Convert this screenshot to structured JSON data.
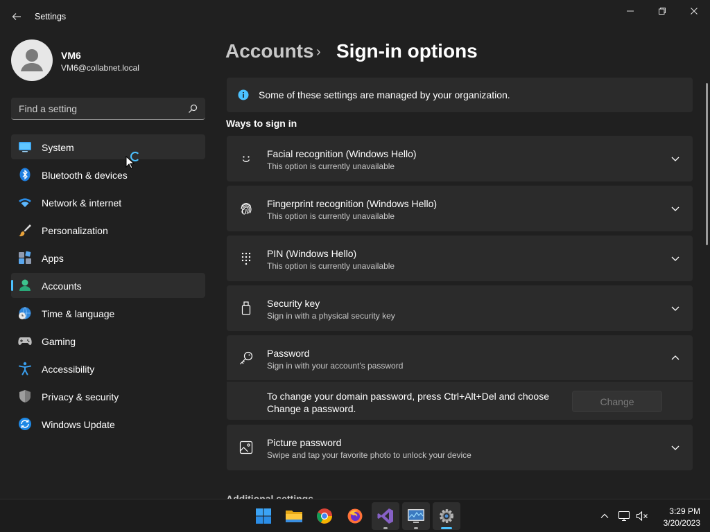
{
  "window": {
    "title": "Settings",
    "minimize_label": "",
    "maximize_label": "",
    "close_label": ""
  },
  "profile": {
    "name": "VM6",
    "email": "VM6@collabnet.local"
  },
  "search": {
    "placeholder": "Find a setting"
  },
  "sidebar": {
    "items": [
      {
        "label": "System",
        "icon": "monitor-icon"
      },
      {
        "label": "Bluetooth & devices",
        "icon": "bluetooth-icon"
      },
      {
        "label": "Network & internet",
        "icon": "wifi-icon"
      },
      {
        "label": "Personalization",
        "icon": "brush-icon"
      },
      {
        "label": "Apps",
        "icon": "apps-icon"
      },
      {
        "label": "Accounts",
        "icon": "person-icon"
      },
      {
        "label": "Time & language",
        "icon": "globe-clock-icon"
      },
      {
        "label": "Gaming",
        "icon": "gamepad-icon"
      },
      {
        "label": "Accessibility",
        "icon": "accessibility-icon"
      },
      {
        "label": "Privacy & security",
        "icon": "shield-icon"
      },
      {
        "label": "Windows Update",
        "icon": "update-icon"
      }
    ],
    "selected": "Accounts"
  },
  "breadcrumb": {
    "parent": "Accounts",
    "separator": "›",
    "current": "Sign-in options"
  },
  "info": {
    "text": "Some of these settings are managed by your organization."
  },
  "ways": {
    "title": "Ways to sign in",
    "cards": [
      {
        "title": "Facial recognition (Windows Hello)",
        "subtitle": "This option is currently unavailable",
        "icon": "smile-icon"
      },
      {
        "title": "Fingerprint recognition (Windows Hello)",
        "subtitle": "This option is currently unavailable",
        "icon": "fingerprint-icon"
      },
      {
        "title": "PIN (Windows Hello)",
        "subtitle": "This option is currently unavailable",
        "icon": "keypad-icon"
      },
      {
        "title": "Security key",
        "subtitle": "Sign in with a physical security key",
        "icon": "usb-key-icon"
      },
      {
        "title": "Password",
        "subtitle": "Sign in with your account's password",
        "icon": "key-icon"
      },
      {
        "title": "Picture password",
        "subtitle": "Swipe and tap your favorite photo to unlock your device",
        "icon": "picture-icon"
      }
    ],
    "password_detail": "To change your domain password, press Ctrl+Alt+Del and choose Change a password.",
    "change_label": "Change"
  },
  "additional_title": "Additional settings",
  "taskbar": {
    "apps": [
      "start-icon",
      "file-explorer-icon",
      "chrome-icon",
      "firefox-icon",
      "visual-studio-icon",
      "resource-monitor-icon",
      "settings-gear-icon"
    ],
    "time": "3:29 PM",
    "date": "3/20/2023"
  },
  "colors": {
    "accent": "#4cc2ff",
    "background": "#202020",
    "card": "#2b2b2b"
  }
}
